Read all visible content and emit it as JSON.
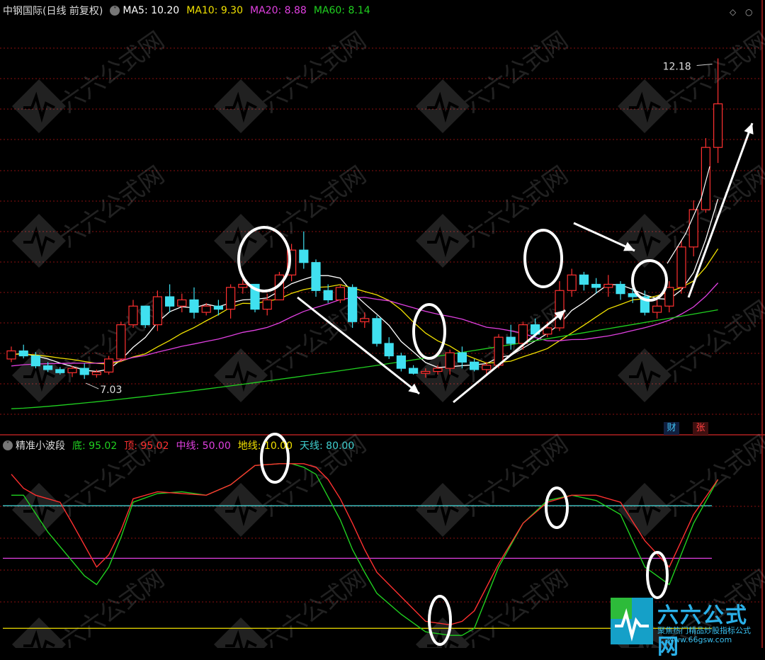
{
  "upper_header": {
    "stock": "中钢国际",
    "mode": "(日线 前复权)",
    "ma": [
      {
        "label": "MA5: 10.20",
        "color": "#ffffff"
      },
      {
        "label": "MA10: 9.30",
        "color": "#f0e000"
      },
      {
        "label": "MA20: 8.88",
        "color": "#e040e0"
      },
      {
        "label": "MA60: 8.14",
        "color": "#20d020"
      }
    ]
  },
  "lower_header": {
    "indicator": "精准小波段",
    "lines": [
      {
        "label": "底: 95.02",
        "color": "#20d020"
      },
      {
        "label": "顶: 95.02",
        "color": "#ff3030"
      },
      {
        "label": "中线: 50.00",
        "color": "#e040e0"
      },
      {
        "label": "地线: 10.00",
        "color": "#f0e000"
      },
      {
        "label": "天线: 80.00",
        "color": "#40d0d0"
      }
    ]
  },
  "badges": {
    "cai": "财",
    "zhang": "张"
  },
  "logo": {
    "name": "六六公式网",
    "slogan": "聚焦热门精品炒股指标公式",
    "url": "www.66gsw.com"
  },
  "watermark": "六六公式网",
  "colors": {
    "up": "#ff3030",
    "down": "#40e0f0",
    "grid": "#8a1010"
  },
  "chart_data": [
    {
      "type": "candlestick",
      "title": "中钢国际 (日线 前复权)",
      "ylim": [
        6.2,
        12.8
      ],
      "annotations": [
        {
          "label": "7.03",
          "type": "low",
          "value": 7.03,
          "at_index": 6
        },
        {
          "label": "12.18",
          "type": "high",
          "value": 12.18,
          "at_index": 58
        }
      ],
      "ohlc": [
        [
          7.35,
          7.55,
          7.3,
          7.48
        ],
        [
          7.48,
          7.58,
          7.36,
          7.4
        ],
        [
          7.4,
          7.46,
          7.2,
          7.24
        ],
        [
          7.24,
          7.3,
          7.14,
          7.18
        ],
        [
          7.18,
          7.22,
          7.1,
          7.13
        ],
        [
          7.13,
          7.24,
          7.06,
          7.2
        ],
        [
          7.2,
          7.28,
          7.03,
          7.1
        ],
        [
          7.1,
          7.18,
          7.05,
          7.14
        ],
        [
          7.14,
          7.4,
          7.1,
          7.35
        ],
        [
          7.35,
          7.95,
          7.3,
          7.9
        ],
        [
          7.9,
          8.3,
          7.85,
          8.2
        ],
        [
          8.2,
          8.2,
          7.85,
          7.9
        ],
        [
          7.9,
          8.45,
          7.8,
          8.35
        ],
        [
          8.35,
          8.55,
          8.1,
          8.2
        ],
        [
          8.2,
          8.4,
          8.1,
          8.3
        ],
        [
          8.3,
          8.5,
          8.0,
          8.1
        ],
        [
          8.1,
          8.25,
          8.05,
          8.2
        ],
        [
          8.2,
          8.3,
          8.05,
          8.15
        ],
        [
          8.15,
          8.55,
          8.0,
          8.5
        ],
        [
          8.5,
          8.65,
          8.4,
          8.55
        ],
        [
          8.55,
          8.55,
          8.1,
          8.15
        ],
        [
          8.15,
          8.4,
          8.05,
          8.3
        ],
        [
          8.3,
          8.75,
          8.3,
          8.7
        ],
        [
          8.7,
          9.2,
          8.6,
          9.1
        ],
        [
          9.1,
          9.4,
          8.8,
          8.9
        ],
        [
          8.9,
          8.95,
          8.35,
          8.45
        ],
        [
          8.45,
          8.55,
          8.25,
          8.3
        ],
        [
          8.3,
          8.55,
          8.25,
          8.5
        ],
        [
          8.5,
          8.55,
          7.85,
          7.95
        ],
        [
          7.95,
          8.1,
          7.85,
          8.0
        ],
        [
          8.0,
          8.05,
          7.55,
          7.6
        ],
        [
          7.6,
          7.7,
          7.35,
          7.4
        ],
        [
          7.4,
          7.45,
          7.15,
          7.2
        ],
        [
          7.2,
          7.25,
          7.1,
          7.12
        ],
        [
          7.12,
          7.2,
          7.05,
          7.15
        ],
        [
          7.15,
          7.25,
          7.1,
          7.2
        ],
        [
          7.2,
          7.5,
          7.1,
          7.45
        ],
        [
          7.45,
          7.55,
          7.2,
          7.3
        ],
        [
          7.3,
          7.35,
          7.15,
          7.18
        ],
        [
          7.18,
          7.3,
          7.1,
          7.25
        ],
        [
          7.25,
          7.75,
          7.2,
          7.7
        ],
        [
          7.7,
          7.9,
          7.5,
          7.6
        ],
        [
          7.6,
          7.95,
          7.5,
          7.9
        ],
        [
          7.9,
          8.0,
          7.7,
          7.75
        ],
        [
          7.75,
          7.95,
          7.7,
          7.85
        ],
        [
          7.85,
          8.6,
          7.8,
          8.45
        ],
        [
          8.45,
          8.8,
          8.35,
          8.7
        ],
        [
          8.7,
          8.75,
          8.45,
          8.55
        ],
        [
          8.55,
          8.65,
          8.4,
          8.5
        ],
        [
          8.5,
          8.7,
          8.35,
          8.55
        ],
        [
          8.55,
          8.6,
          8.3,
          8.4
        ],
        [
          8.4,
          8.55,
          8.25,
          8.35
        ],
        [
          8.35,
          8.45,
          8.05,
          8.1
        ],
        [
          8.1,
          8.3,
          8.0,
          8.2
        ],
        [
          8.2,
          8.6,
          8.1,
          8.5
        ],
        [
          8.5,
          9.25,
          8.4,
          9.15
        ],
        [
          9.15,
          9.9,
          9.0,
          9.75
        ],
        [
          9.75,
          10.9,
          9.7,
          10.75
        ],
        [
          10.75,
          12.18,
          10.5,
          11.45
        ]
      ],
      "ma_start": [
        {
          "name": "MA5",
          "start": 7.35,
          "end": 10.2
        },
        {
          "name": "MA10",
          "start": 7.36,
          "end": 9.3
        },
        {
          "name": "MA20",
          "start": 6.97,
          "end": 8.88
        },
        {
          "name": "MA60",
          "start": 6.55,
          "end": 8.14
        }
      ]
    },
    {
      "type": "line",
      "title": "精准小波段",
      "ylim": [
        0,
        110
      ],
      "series": [
        {
          "name": "底",
          "color": "#20d020",
          "x": [
            0,
            1,
            3,
            6,
            7,
            8,
            9,
            10,
            12,
            14,
            16,
            18,
            20,
            22,
            23,
            24,
            25,
            26,
            27,
            28,
            29,
            30,
            32,
            34,
            36,
            37,
            38,
            40,
            42,
            44,
            46,
            48,
            50,
            52,
            54,
            56,
            58
          ],
          "values": [
            86,
            86,
            65,
            40,
            35,
            45,
            62,
            82,
            87,
            88,
            86,
            92,
            103,
            104,
            104,
            102,
            98,
            85,
            72,
            55,
            42,
            30,
            18,
            8,
            6,
            6,
            10,
            45,
            70,
            83,
            86,
            83,
            75,
            45,
            35,
            70,
            95
          ]
        },
        {
          "name": "顶",
          "color": "#ff3030",
          "x": [
            0,
            1,
            2,
            4,
            5,
            7,
            8,
            9,
            10,
            12,
            14,
            16,
            18,
            20,
            22,
            23,
            24,
            25,
            26,
            27,
            28,
            29,
            30,
            32,
            34,
            36,
            37,
            38,
            40,
            42,
            44,
            46,
            48,
            50,
            52,
            54,
            56,
            58
          ],
          "values": [
            98,
            90,
            86,
            82,
            70,
            45,
            52,
            66,
            84,
            88,
            87,
            86,
            92,
            103,
            104,
            104,
            104,
            102,
            95,
            84,
            70,
            55,
            42,
            28,
            14,
            12,
            14,
            20,
            47,
            70,
            82,
            86,
            86,
            82,
            60,
            45,
            75,
            95
          ]
        }
      ],
      "levels": [
        {
          "name": "天线",
          "value": 80,
          "color": "#40d0d0"
        },
        {
          "name": "中线",
          "value": 50,
          "color": "#e040e0"
        },
        {
          "name": "地线",
          "value": 10,
          "color": "#f0e000"
        }
      ]
    }
  ]
}
